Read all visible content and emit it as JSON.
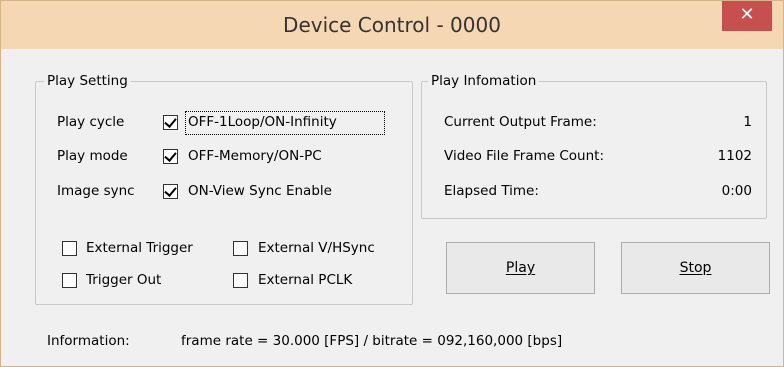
{
  "window": {
    "title": "Device Control - 0000",
    "close_glyph": "✕"
  },
  "play_setting": {
    "group_label": "Play Setting",
    "rows": [
      {
        "label": "Play cycle",
        "option": "OFF-1Loop/ON-Infinity",
        "checked": true
      },
      {
        "label": "Play mode",
        "option": "OFF-Memory/ON-PC",
        "checked": true
      },
      {
        "label": "Image sync",
        "option": "ON-View Sync Enable",
        "checked": true
      }
    ],
    "options": [
      {
        "label": "External Trigger",
        "checked": false
      },
      {
        "label": "External V/HSync",
        "checked": false
      },
      {
        "label": "Trigger Out",
        "checked": false
      },
      {
        "label": "External PCLK",
        "checked": false
      }
    ]
  },
  "play_info": {
    "group_label": "Play Infomation",
    "rows": [
      {
        "label": "Current Output Frame:",
        "value": "1"
      },
      {
        "label": "Video File Frame Count:",
        "value": "1102"
      },
      {
        "label": "Elapsed Time:",
        "value": "0:00"
      }
    ]
  },
  "buttons": {
    "play": "Play",
    "stop": "Stop"
  },
  "status": {
    "label": "Information:",
    "text": "frame rate = 30.000 [FPS] / bitrate = 092,160,000 [bps]"
  },
  "colors": {
    "titlebar": "#f6d7b3",
    "close_button": "#c7504f",
    "client": "#f0f0f0"
  }
}
